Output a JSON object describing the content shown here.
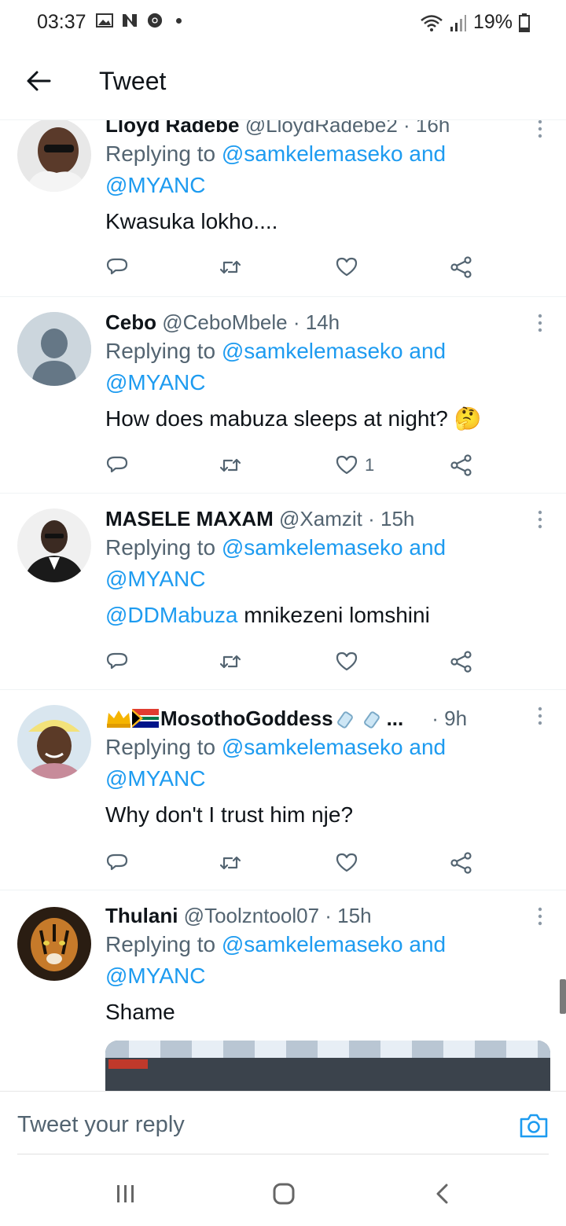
{
  "status": {
    "time": "03:37",
    "battery": "19%"
  },
  "header": {
    "title": "Tweet"
  },
  "tweets": [
    {
      "name": "Lloyd Radebe",
      "handle": "@LloydRadebe2",
      "time": "· 16h",
      "replying_prefix": "Replying to",
      "mention1": "@samkelemaseko",
      "and": "and",
      "mention2": "@MYANC",
      "text": "Kwasuka lokho....",
      "likes": ""
    },
    {
      "name": "Cebo",
      "handle": "@CeboMbele",
      "time": "· 14h",
      "replying_prefix": "Replying to",
      "mention1": "@samkelemaseko",
      "and": "and",
      "mention2": "@MYANC",
      "text": "How does mabuza sleeps at night? 🤔",
      "likes": "1"
    },
    {
      "name": "MASELE MAXAM",
      "handle": "@Xamzit",
      "time": "· 15h",
      "replying_prefix": "Replying to",
      "mention1": "@samkelemaseko",
      "and": "and",
      "mention2": "@MYANC",
      "text_link": "@DDMabuza",
      "text": "mnikezeni lomshini",
      "likes": ""
    },
    {
      "name": "MosothoGoddess",
      "name_suffix": "...",
      "time": "· 9h",
      "replying_prefix": "Replying to",
      "mention1": "@samkelemaseko",
      "and": "and",
      "mention2": "@MYANC",
      "text": "Why don't I trust him nje?",
      "likes": ""
    },
    {
      "name": "Thulani",
      "handle": "@Toolzntool07",
      "time": "· 15h",
      "replying_prefix": "Replying to",
      "mention1": "@samkelemaseko",
      "and": "and",
      "mention2": "@MYANC",
      "text": "Shame",
      "likes": ""
    }
  ],
  "reply_bar": {
    "placeholder": "Tweet your reply"
  },
  "colors": {
    "link": "#1d9bf0",
    "secondary": "#536471",
    "text": "#0f1419"
  },
  "icons": [
    "back-arrow-icon",
    "more-vert-icon",
    "reply-icon",
    "retweet-icon",
    "like-icon",
    "share-icon",
    "camera-icon",
    "recent-apps-icon",
    "home-icon",
    "nav-back-icon"
  ]
}
